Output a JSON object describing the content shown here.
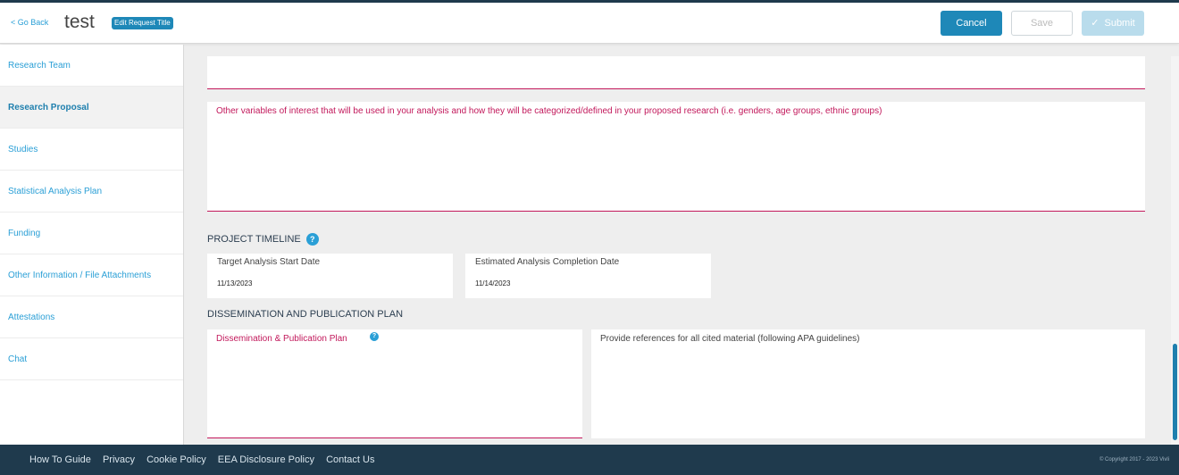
{
  "header": {
    "go_back": "< Go Back",
    "title": "test",
    "edit_title": "Edit Request Title",
    "cancel": "Cancel",
    "save": "Save",
    "submit": "Submit"
  },
  "sidebar": {
    "items": [
      {
        "label": "Research Team"
      },
      {
        "label": "Research Proposal"
      },
      {
        "label": "Studies"
      },
      {
        "label": "Statistical Analysis Plan"
      },
      {
        "label": "Funding"
      },
      {
        "label": "Other Information / File Attachments"
      },
      {
        "label": "Attestations"
      },
      {
        "label": "Chat"
      }
    ],
    "active": "Research Proposal"
  },
  "main": {
    "other_variables_label": "Other variables of interest that will be used in your analysis and how they will be categorized/defined in your proposed research (i.e. genders, age groups, ethnic groups)",
    "project_timeline": {
      "title": "PROJECT TIMELINE",
      "start_label": "Target Analysis Start Date",
      "start_value": "11/13/2023",
      "end_label": "Estimated Analysis Completion Date",
      "end_value": "11/14/2023"
    },
    "dissemination": {
      "title": "DISSEMINATION AND PUBLICATION PLAN",
      "plan_label": "Dissemination & Publication Plan",
      "references_label": "Provide references for all cited material (following APA guidelines)"
    },
    "help_glyph": "?"
  },
  "footer": {
    "links": [
      "How To Guide",
      "Privacy",
      "Cookie Policy",
      "EEA Disclosure Policy",
      "Contact Us"
    ],
    "copyright": "© Copyright 2017 - 2023 Vivli"
  },
  "colors": {
    "brand_blue": "#1e88b8",
    "link_blue": "#2a9fd6",
    "required_red": "#c2185b",
    "footer_navy": "#1f3a4d"
  },
  "icons": {
    "submit": "check-icon",
    "help": "help-circle-icon"
  }
}
